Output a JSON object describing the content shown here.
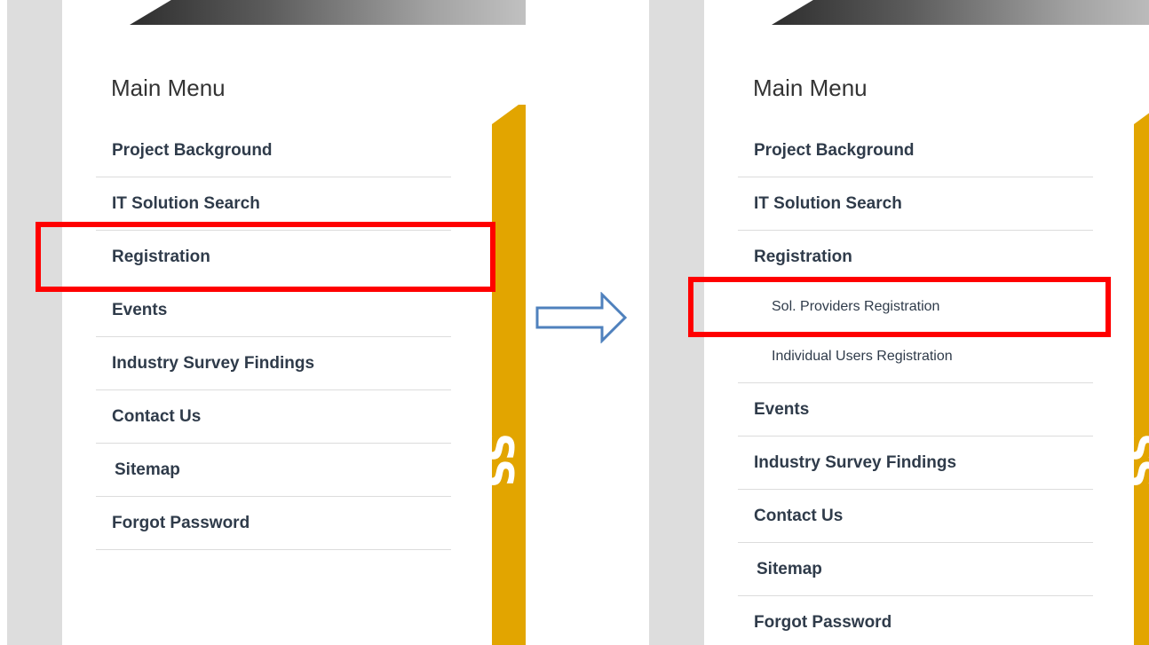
{
  "left_panel": {
    "title": "Main Menu",
    "items": [
      {
        "label": "Project Background"
      },
      {
        "label": "IT Solution Search"
      },
      {
        "label": "Registration"
      },
      {
        "label": "Events"
      },
      {
        "label": "Industry Survey Findings"
      },
      {
        "label": "Contact Us"
      },
      {
        "label": "Sitemap"
      },
      {
        "label": "Forgot Password"
      }
    ]
  },
  "right_panel": {
    "title": "Main Menu",
    "items": [
      {
        "label": "Project Background"
      },
      {
        "label": "IT Solution Search"
      },
      {
        "label": "Registration"
      },
      {
        "label": "Events"
      },
      {
        "label": "Industry Survey Findings"
      },
      {
        "label": "Contact Us"
      },
      {
        "label": "Sitemap"
      },
      {
        "label": "Forgot Password"
      }
    ],
    "registration_submenu": [
      {
        "label": "Sol. Providers Registration"
      },
      {
        "label": "Individual Users Registration"
      }
    ]
  },
  "colors": {
    "highlight": "#ff0000",
    "arrow": "#4f81bd",
    "accent_band": "#e2a500",
    "side_strip": "#dddddd"
  },
  "icons": {
    "transition": "right-arrow-icon"
  }
}
